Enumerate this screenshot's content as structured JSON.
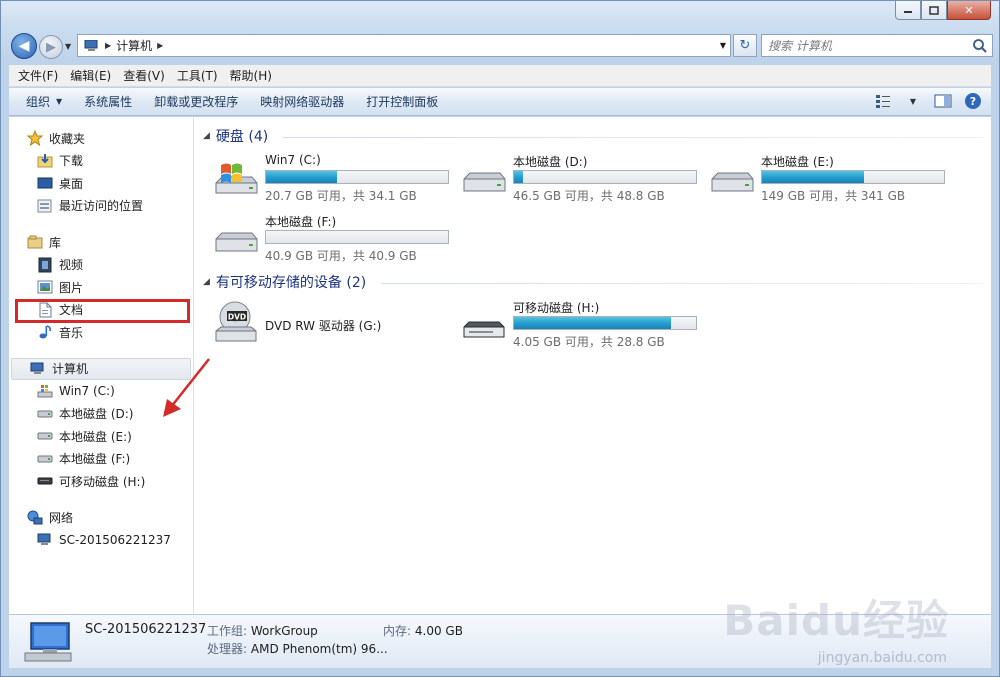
{
  "window": {
    "caption_min": "▭",
    "caption_max": "▢",
    "caption_close": "✕"
  },
  "address": {
    "crumb": "计算机",
    "search_placeholder": "搜索 计算机"
  },
  "menu": [
    "文件(F)",
    "编辑(E)",
    "查看(V)",
    "工具(T)",
    "帮助(H)"
  ],
  "commands": {
    "organize": "组织",
    "system_props": "系统属性",
    "uninstall": "卸载或更改程序",
    "map_drive": "映射网络驱动器",
    "control_panel": "打开控制面板"
  },
  "nav": {
    "favorites": "收藏夹",
    "downloads": "下载",
    "desktop": "桌面",
    "recent": "最近访问的位置",
    "libraries": "库",
    "videos": "视频",
    "pictures": "图片",
    "documents": "文档",
    "music": "音乐",
    "computer": "计算机",
    "drive_c": "Win7 (C:)",
    "drive_d": "本地磁盘 (D:)",
    "drive_e": "本地磁盘 (E:)",
    "drive_f": "本地磁盘 (F:)",
    "drive_h": "可移动磁盘 (H:)",
    "network": "网络",
    "network_pc": "SC-201506221237"
  },
  "sections": {
    "hdd": "硬盘 (4)",
    "removable": "有可移动存储的设备 (2)"
  },
  "drives": {
    "c": {
      "name": "Win7 (C:)",
      "info": "20.7 GB 可用，共 34.1 GB",
      "used": 0.39
    },
    "d": {
      "name": "本地磁盘 (D:)",
      "info": "46.5 GB 可用，共 48.8 GB",
      "used": 0.05
    },
    "e": {
      "name": "本地磁盘 (E:)",
      "info": "149 GB 可用，共 341 GB",
      "used": 0.56
    },
    "f": {
      "name": "本地磁盘 (F:)",
      "info": "40.9 GB 可用，共 40.9 GB",
      "used": 0.0
    },
    "g": {
      "name": "DVD RW 驱动器 (G:)",
      "label": "DVD"
    },
    "h": {
      "name": "可移动磁盘 (H:)",
      "info": "4.05 GB 可用，共 28.8 GB",
      "used": 0.86
    }
  },
  "details": {
    "pc_name": "SC-201506221237",
    "workgroup_label": "工作组:",
    "workgroup": "WorkGroup",
    "memory_label": "内存:",
    "memory": "4.00 GB",
    "cpu_label": "处理器:",
    "cpu": "AMD Phenom(tm) 96..."
  },
  "watermark": {
    "main": "Baidu经验",
    "sub": "jingyan.baidu.com"
  },
  "colors": {
    "bar_fill": "#26a0d0",
    "highlight": "#d42a2a"
  }
}
